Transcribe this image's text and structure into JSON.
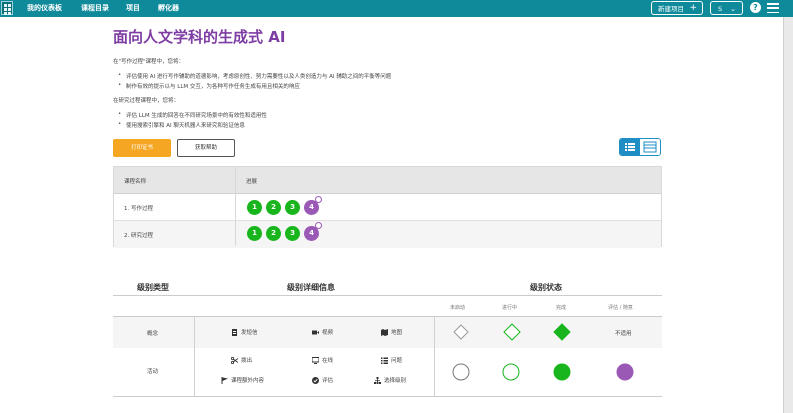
{
  "nav": {
    "items": [
      "我的仪表板",
      "课程目录",
      "项目",
      "孵化器"
    ],
    "new_project": "新建项目",
    "user_initial": "S",
    "help": "?"
  },
  "page": {
    "title": "面向人文学科的生成式 AI",
    "intro_writing": "在\"写作过程\"课程中，您将：",
    "writing_bullets": [
      "评估使用 AI 进行写作辅助的道德影响，考虑原创性、努力需要性以及人类创造力与 AI 辅助之间的平衡等问题",
      "制作有效的提示以与 LLM 交互，为各种写作任务生成有用且相关的响应"
    ],
    "intro_research": "在研究过程课程中，您将：",
    "research_bullets": [
      "评估 LLM 生成的回答在不同研究场景中的有效性和适用性",
      "使用搜索引擎和 AI 聊天机器人来研究和验证信息"
    ],
    "print_button": "打印证书",
    "help_button": "获取帮助"
  },
  "progress": {
    "col_course": "课程名称",
    "col_progress": "进展",
    "rows": [
      {
        "name": "1. 写作过程",
        "levels": [
          "1",
          "2",
          "3",
          "4"
        ]
      },
      {
        "name": "2. 研究过程",
        "levels": [
          "1",
          "2",
          "3",
          "4"
        ]
      }
    ]
  },
  "legend": {
    "h_type": "级别类型",
    "h_details": "级别详细信息",
    "h_status": "级别状态",
    "status_cols": [
      "未启动",
      "进行中",
      "完成",
      "评估 / 随意"
    ],
    "rows": [
      {
        "type": "概念",
        "items": [
          "发短信",
          "视频",
          "地图"
        ],
        "last": "不适用"
      },
      {
        "type": "活动",
        "items": [
          "拨出",
          "在线",
          "问题",
          "课程额外内容",
          "评估",
          "选择级别"
        ]
      }
    ]
  },
  "colors": {
    "topbar": "#0e8a9a",
    "title": "#7e3da3",
    "green": "#19b51c",
    "purple": "#9b59b6",
    "orange": "#f5a623",
    "toggle": "#1e8ec4"
  }
}
